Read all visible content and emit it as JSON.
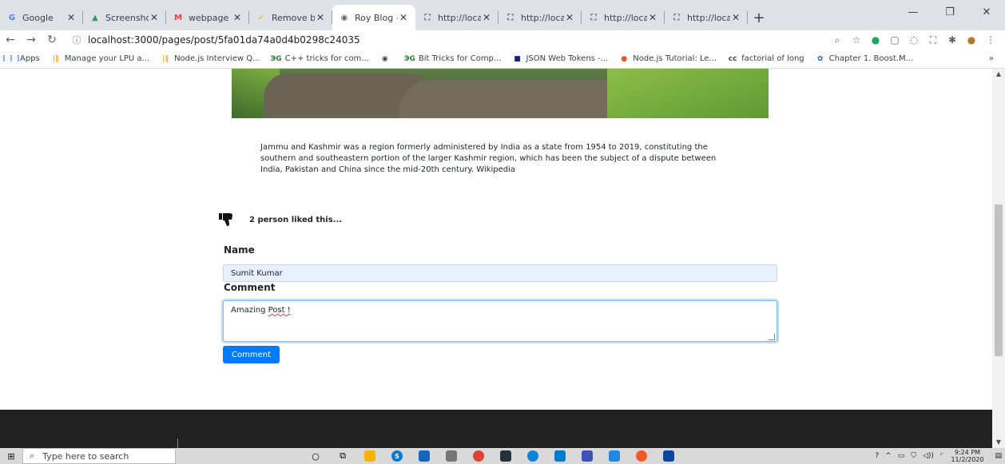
{
  "browser": {
    "tabs": [
      {
        "title": "Google",
        "favicon": "G",
        "color": "#4285f4",
        "active": false
      },
      {
        "title": "Screenshot",
        "favicon": "▲",
        "color": "#1fa463",
        "active": false
      },
      {
        "title": "webpage p",
        "favicon": "M",
        "color": "#ea4335",
        "active": false
      },
      {
        "title": "Remove by",
        "favicon": "✓",
        "color": "#f9a825",
        "active": false
      },
      {
        "title": "Roy Blog - P",
        "favicon": "◉",
        "color": "#5f6368",
        "active": true
      },
      {
        "title": "http://locall",
        "favicon": "⛶",
        "color": "#5f6368",
        "active": false
      },
      {
        "title": "http://locall",
        "favicon": "⛶",
        "color": "#5f6368",
        "active": false
      },
      {
        "title": "http://locall",
        "favicon": "⛶",
        "color": "#5f6368",
        "active": false
      },
      {
        "title": "http://locall",
        "favicon": "⛶",
        "color": "#5f6368",
        "active": false
      }
    ],
    "url": "localhost:3000/pages/post/5fa01da74a0d4b0298c24035",
    "bookmarks": [
      {
        "label": "Apps",
        "icon": "⋮⋮⋮",
        "color": "#1a73e8"
      },
      {
        "label": "Manage your LPU a...",
        "icon": "|‖",
        "color": "#f9a825"
      },
      {
        "label": "Node.js Interview Q...",
        "icon": "|‖",
        "color": "#f9a825"
      },
      {
        "label": "C++ tricks for com...",
        "icon": "ЭG",
        "color": "#2e7d32"
      },
      {
        "label": "",
        "icon": "◉",
        "color": "#3c4043"
      },
      {
        "label": "Bit Tricks for Comp...",
        "icon": "ЭG",
        "color": "#2e7d32"
      },
      {
        "label": "JSON Web Tokens -...",
        "icon": "■",
        "color": "#1a237e"
      },
      {
        "label": "Node.js Tutorial: Le...",
        "icon": "●",
        "color": "#f4511e"
      },
      {
        "label": "factorial of long",
        "icon": "cc",
        "color": "#37474f"
      },
      {
        "label": "Chapter 1. Boost.M...",
        "icon": "✿",
        "color": "#1565c0"
      }
    ],
    "bookmarks_more": "»"
  },
  "post": {
    "body": "Jammu and Kashmir was a region formerly administered by India as a state from 1954 to 2019, constituting the southern and southeastern portion of the larger Kashmir region, which has been the subject of a dispute between India, Pakistan and China since the mid-20th century. Wikipedia",
    "likes_text": "2 person liked this..."
  },
  "form": {
    "name_label": "Name",
    "name_value": "Sumit Kumar",
    "comment_label": "Comment",
    "comment_value_prefix": "Amazing ",
    "comment_value_misspelled": "Post !",
    "submit_label": "Comment"
  },
  "taskbar": {
    "search_placeholder": "Type here to search",
    "time": "9:24 PM",
    "date": "11/2/2020"
  },
  "colors": {
    "primary": "#007bff",
    "footer": "#212121",
    "autofill": "#e8f0fe"
  }
}
